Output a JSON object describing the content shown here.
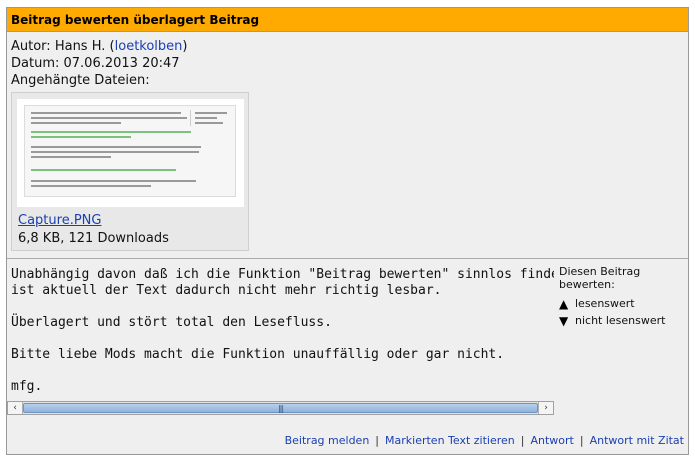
{
  "post": {
    "title": "Beitrag bewerten überlagert Beitrag",
    "author_label": "Autor:",
    "author_name": "Hans H.",
    "author_username": "loetkolben",
    "date_label": "Datum:",
    "date": "07.06.2013 20:47",
    "attachments_label": "Angehängte Dateien:",
    "attachment": {
      "filename": "Capture.PNG",
      "info": "6,8 KB, 121 Downloads"
    },
    "body_lines": [
      "Unabhängig davon daß ich die Funktion \"Beitrag bewerten\" sinnlos finde,",
      "ist aktuell der Text dadurch nicht mehr richtig lesbar.",
      "",
      "Überlagert und stört total den Lesefluss.",
      "",
      "Bitte liebe Mods macht die Funktion unauffällig oder gar nicht.",
      "",
      "mfg."
    ]
  },
  "rating": {
    "title": "Diesen Beitrag bewerten:",
    "up_label": "lesenswert",
    "down_label": "nicht lesenswert"
  },
  "scrollbar": {
    "left_arrow": "‹",
    "right_arrow": "›",
    "grip": "|||"
  },
  "footer": {
    "report": "Beitrag melden",
    "quote_selected": "Markierten Text zitieren",
    "reply": "Antwort",
    "reply_quote": "Antwort mit Zitat"
  },
  "colors": {
    "header_bg": "#ffaa00",
    "post_bg": "#efefef",
    "link": "#1a3fb0"
  }
}
